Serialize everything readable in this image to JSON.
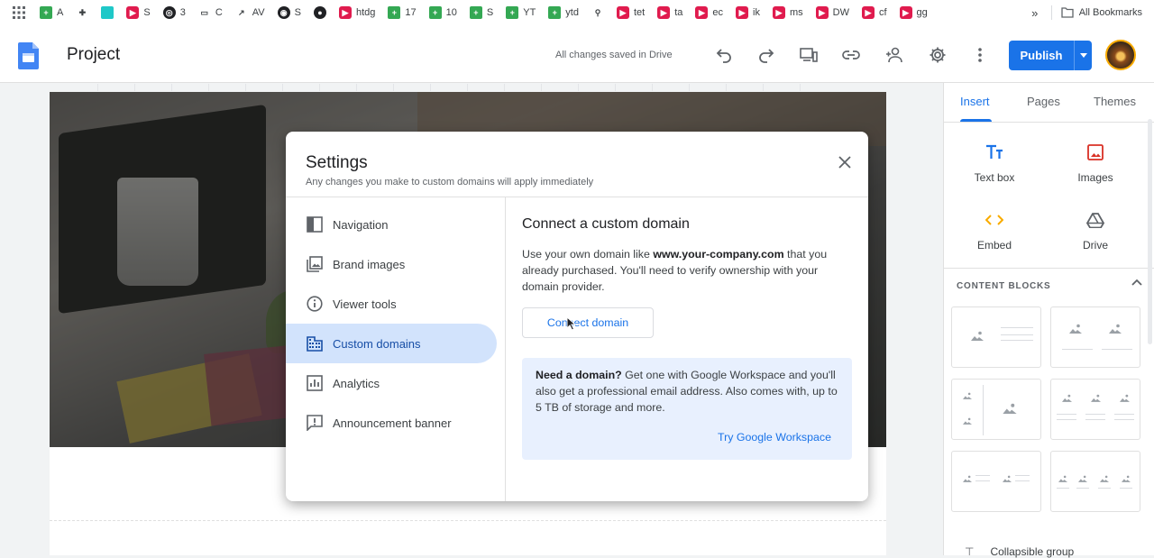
{
  "bookmarks": {
    "items": [
      {
        "icon": "apps-grid-icon",
        "label": ""
      },
      {
        "icon": "sheets-icon",
        "label": "A"
      },
      {
        "icon": "puzzle-icon",
        "label": ""
      },
      {
        "icon": "teal-app-icon",
        "label": ""
      },
      {
        "icon": "youtube-icon",
        "label": "S"
      },
      {
        "icon": "circle-icon",
        "label": "3"
      },
      {
        "icon": "folder-icon",
        "label": "C"
      },
      {
        "icon": "trend-icon",
        "label": "AV"
      },
      {
        "icon": "globe-icon",
        "label": "S"
      },
      {
        "icon": "github-icon",
        "label": ""
      },
      {
        "icon": "youtube-icon",
        "label": "htdg"
      },
      {
        "icon": "sheets-icon",
        "label": "17"
      },
      {
        "icon": "sheets-icon",
        "label": "10"
      },
      {
        "icon": "sheets-icon",
        "label": "S"
      },
      {
        "icon": "sheets-icon",
        "label": "YT"
      },
      {
        "icon": "sheets-icon",
        "label": "ytd"
      },
      {
        "icon": "pin-icon",
        "label": ""
      },
      {
        "icon": "youtube-icon",
        "label": "tet"
      },
      {
        "icon": "youtube-icon",
        "label": "ta"
      },
      {
        "icon": "youtube-icon",
        "label": "ec"
      },
      {
        "icon": "youtube-icon",
        "label": "ik"
      },
      {
        "icon": "youtube-icon",
        "label": "ms"
      },
      {
        "icon": "youtube-icon",
        "label": "DW"
      },
      {
        "icon": "youtube-icon",
        "label": "cf"
      },
      {
        "icon": "youtube-icon",
        "label": "gg"
      }
    ],
    "more": "»",
    "all_bookmarks": "All Bookmarks"
  },
  "header": {
    "title": "Project",
    "saved_status": "All changes saved in Drive",
    "publish_label": "Publish"
  },
  "side_panel": {
    "tabs": [
      "Insert",
      "Pages",
      "Themes"
    ],
    "active_tab": "Insert",
    "insert_items": [
      {
        "label": "Text box",
        "icon": "text-box-icon"
      },
      {
        "label": "Images",
        "icon": "images-icon"
      },
      {
        "label": "Embed",
        "icon": "embed-icon"
      },
      {
        "label": "Drive",
        "icon": "drive-icon"
      }
    ],
    "content_blocks_title": "CONTENT BLOCKS",
    "collapsible_label": "Collapsible group"
  },
  "modal": {
    "title": "Settings",
    "subtitle": "Any changes you make to custom domains will apply immediately",
    "nav": [
      {
        "label": "Navigation",
        "icon": "navigation-icon"
      },
      {
        "label": "Brand images",
        "icon": "brand-images-icon"
      },
      {
        "label": "Viewer tools",
        "icon": "info-icon"
      },
      {
        "label": "Custom domains",
        "icon": "domain-icon"
      },
      {
        "label": "Analytics",
        "icon": "analytics-icon"
      },
      {
        "label": "Announcement banner",
        "icon": "announcement-icon"
      }
    ],
    "active_nav": "Custom domains",
    "heading": "Connect a custom domain",
    "desc_pre": "Use your own domain like ",
    "desc_bold": "www.your-company.com",
    "desc_post": " that you already purchased. You'll need to verify ownership with your domain provider.",
    "connect_label": "Connect domain",
    "info_bold": "Need a domain?",
    "info_text": " Get one with Google Workspace and you'll also get a professional email address. Also comes with, up to 5 TB of storage and more.",
    "info_link": "Try Google Workspace"
  },
  "colors": {
    "accent": "#1a73e8",
    "active_nav_bg": "#d2e3fc",
    "info_bg": "#e8f0fe"
  }
}
